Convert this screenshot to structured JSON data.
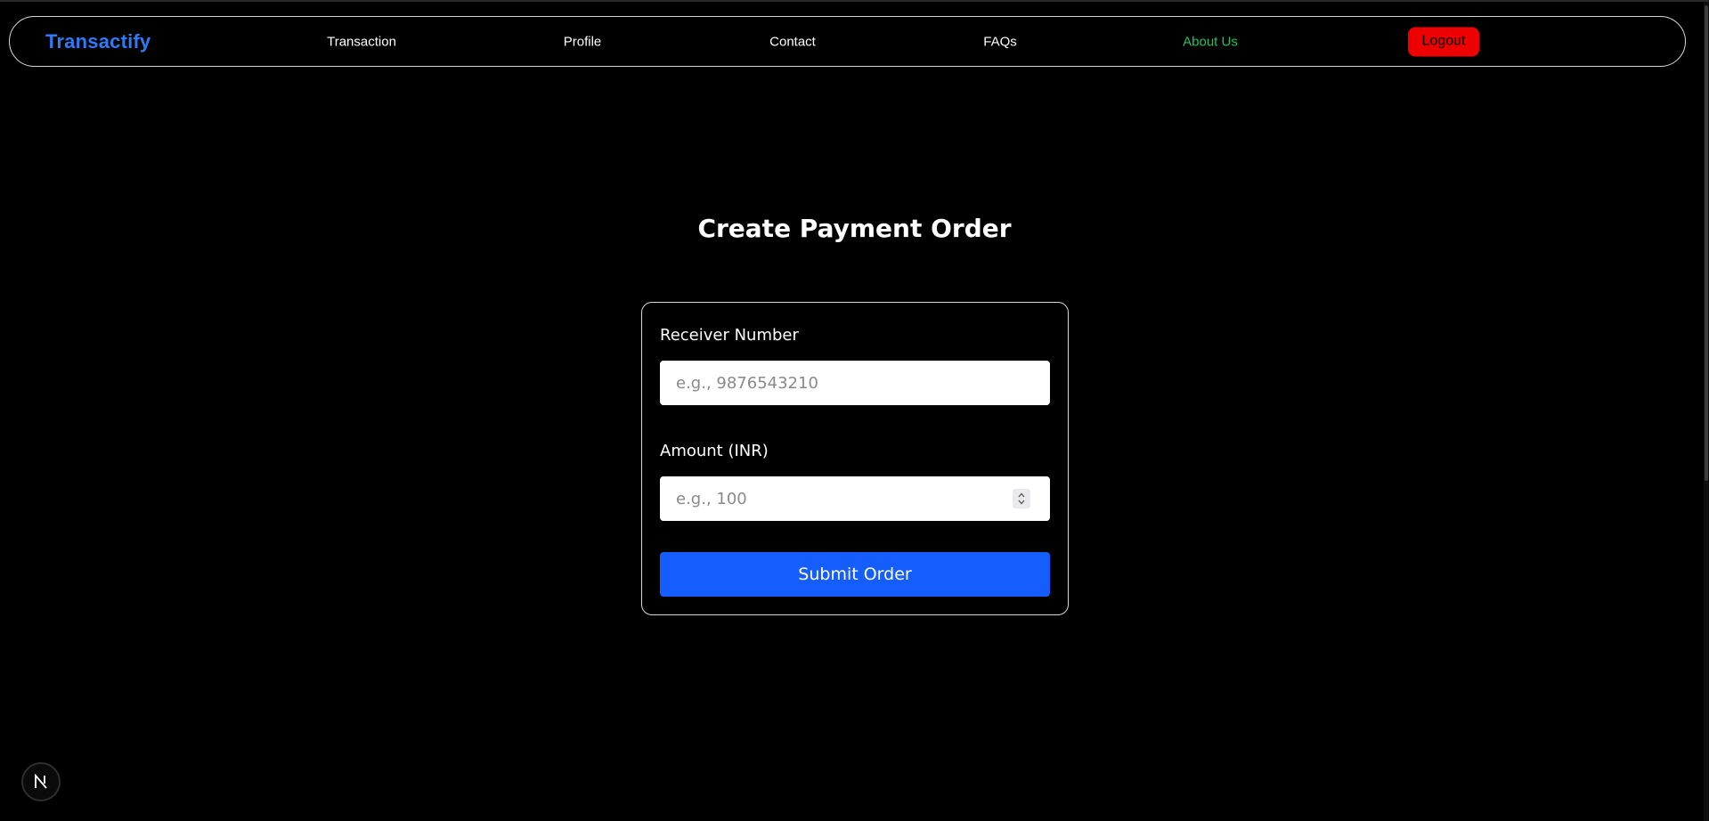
{
  "navbar": {
    "brand": "Transactify",
    "links": [
      {
        "label": "Transaction"
      },
      {
        "label": "Profile"
      },
      {
        "label": "Contact"
      },
      {
        "label": "FAQs"
      },
      {
        "label": "About Us",
        "active": true
      }
    ],
    "logout_label": "Logout"
  },
  "main": {
    "title": "Create Payment Order",
    "form": {
      "receiver": {
        "label": "Receiver Number",
        "value": "",
        "placeholder": "e.g., 9876543210"
      },
      "amount": {
        "label": "Amount (INR)",
        "value": "",
        "placeholder": "e.g., 100"
      },
      "submit_label": "Submit Order"
    }
  },
  "dev_indicator": {
    "icon": "nextjs-n-icon",
    "glyph": "N"
  },
  "colors": {
    "background": "#000000",
    "brand": "#2f7bf5",
    "active_link": "#22c55e",
    "logout_bg": "#ee0000",
    "submit_bg": "#155dfc",
    "border": "#d9d9d9"
  }
}
